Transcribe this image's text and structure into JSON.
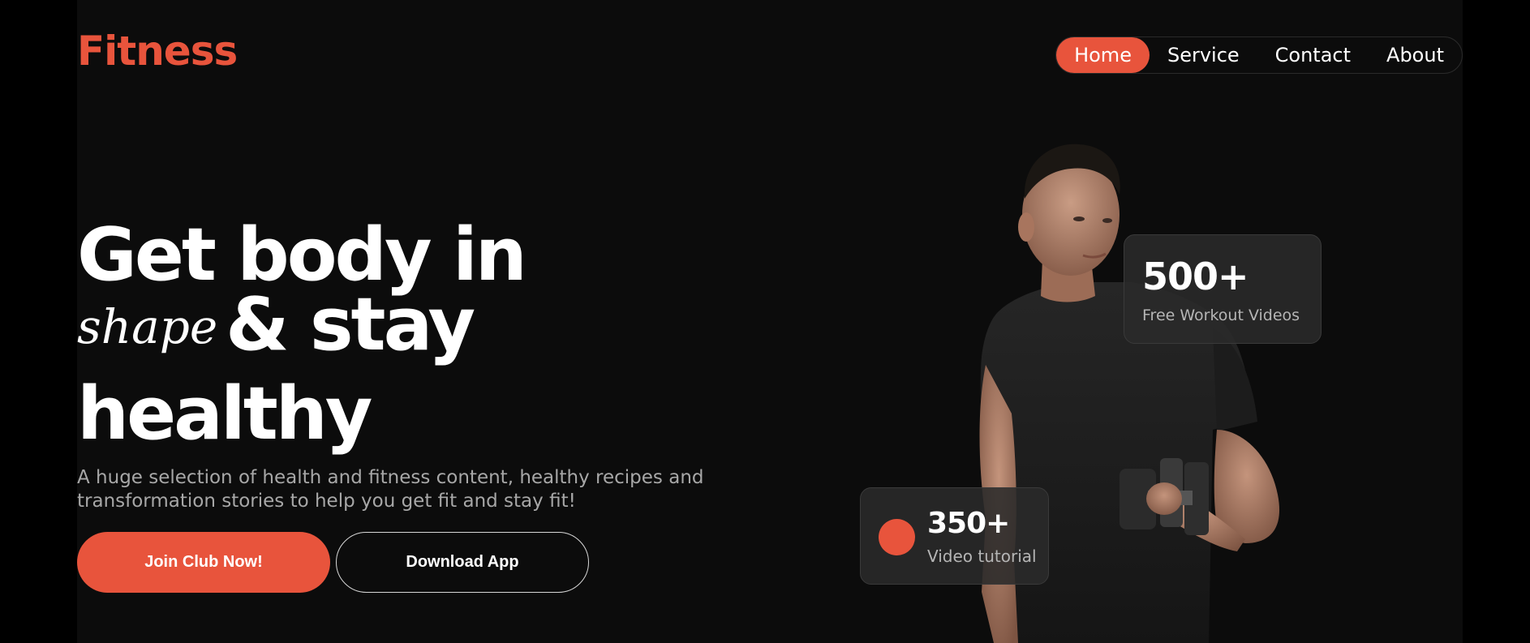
{
  "brand": {
    "logo": "Fitness",
    "accent": "#e8543c"
  },
  "nav": {
    "items": [
      {
        "label": "Home",
        "active": true
      },
      {
        "label": "Service",
        "active": false
      },
      {
        "label": "Contact",
        "active": false
      },
      {
        "label": "About",
        "active": false
      }
    ]
  },
  "hero": {
    "headline_line1": "Get body in",
    "headline_script": "shape",
    "headline_line2": "& stay",
    "headline_line3": "healthy",
    "subtitle": "A huge selection of health and fitness content, healthy recipes and transformation stories to help you get fit and stay fit!",
    "join_button": "Join Club Now!",
    "download_button": "Download App"
  },
  "stats": [
    {
      "value": "500+",
      "label": "Free Workout Videos"
    },
    {
      "value": "350+",
      "label": "Video tutorial"
    }
  ]
}
